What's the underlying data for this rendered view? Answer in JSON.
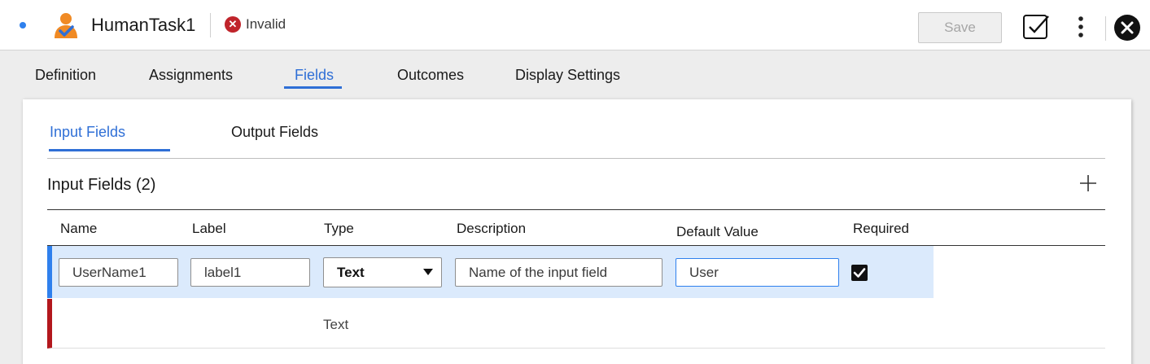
{
  "header": {
    "title": "HumanTask1",
    "status": "Invalid",
    "save_label": "Save",
    "icons": [
      "human-task-icon",
      "invalid-icon",
      "validate-icon",
      "more-icon",
      "close-icon"
    ],
    "colors": {
      "accent": "#2f6fd6",
      "error": "#c0242b",
      "task_orange": "#f08a24"
    }
  },
  "tabs": [
    {
      "label": "Definition",
      "active": false
    },
    {
      "label": "Assignments",
      "active": false
    },
    {
      "label": "Fields",
      "active": true
    },
    {
      "label": "Outcomes",
      "active": false
    },
    {
      "label": "Display Settings",
      "active": false
    }
  ],
  "subtabs": [
    {
      "label": "Input Fields",
      "active": true
    },
    {
      "label": "Output Fields",
      "active": false
    }
  ],
  "section": {
    "title": "Input Fields (2)",
    "add_icon": "plus-icon"
  },
  "table": {
    "columns": [
      "Name",
      "Label",
      "Type",
      "Description",
      "Default Value",
      "Required"
    ],
    "rows": [
      {
        "name": "UserName1",
        "label": "label1",
        "type": "Text",
        "description": "Name of the input field",
        "default_value": "User",
        "required": true
      },
      {
        "name": "",
        "label": "",
        "type": "Text",
        "description": "",
        "default_value": "",
        "required": false
      }
    ]
  }
}
